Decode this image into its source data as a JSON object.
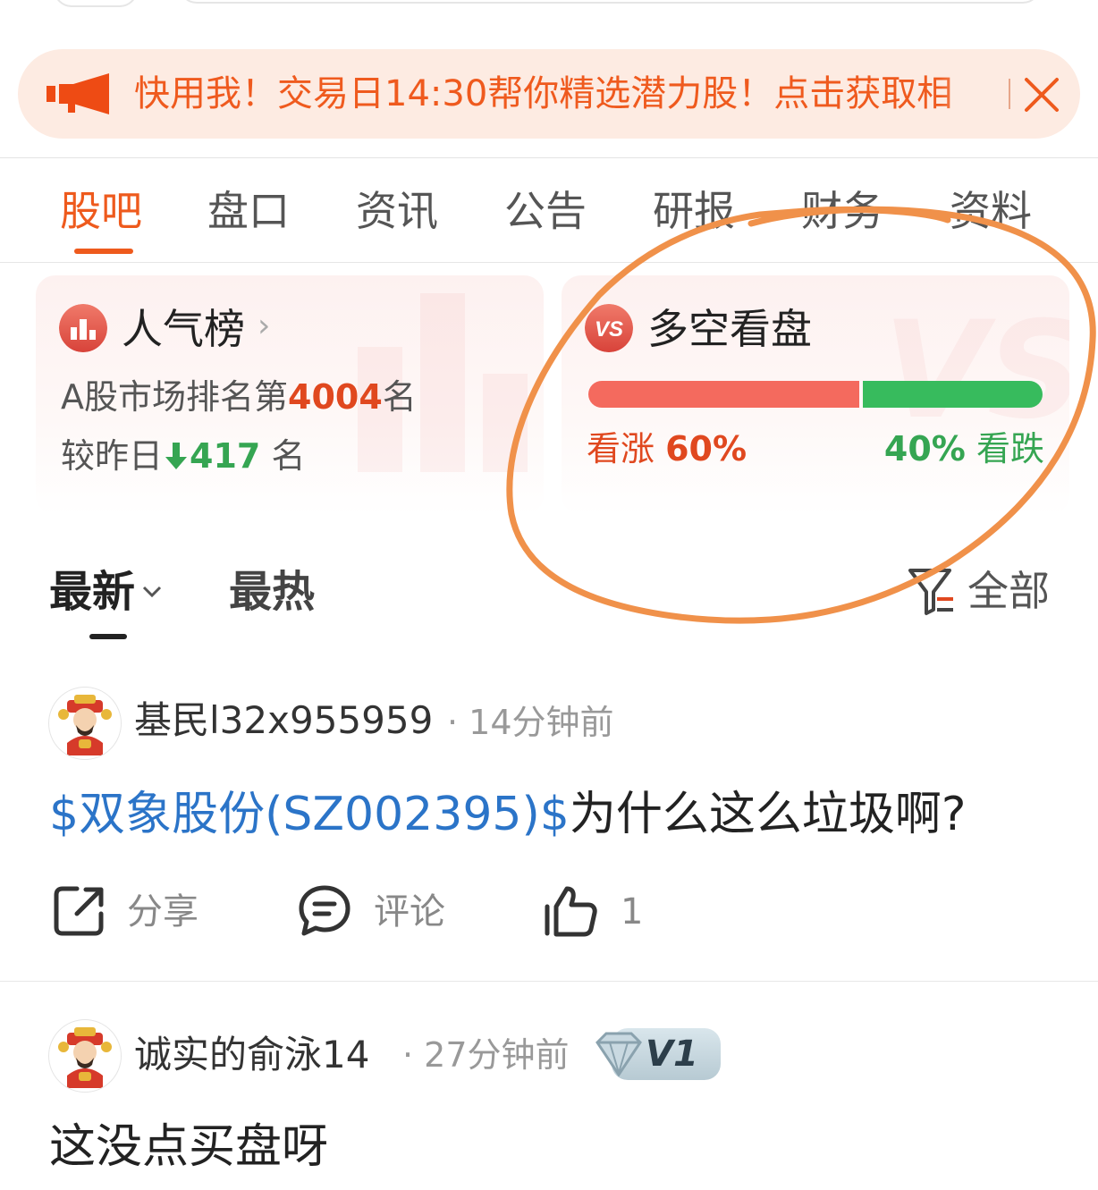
{
  "banner": {
    "text": "快用我！交易日14:30帮你精选潜力股！点击获取相",
    "icon": "megaphone-icon",
    "close_icon": "close-icon"
  },
  "tabs": [
    {
      "label": "股吧",
      "active": true
    },
    {
      "label": "盘口"
    },
    {
      "label": "资讯"
    },
    {
      "label": "公告"
    },
    {
      "label": "研报"
    },
    {
      "label": "财务"
    },
    {
      "label": "资料"
    }
  ],
  "popularity": {
    "title": "人气榜",
    "rank_prefix": "A股市场排名第",
    "rank": "4004",
    "rank_suffix": "名",
    "change_prefix": "较昨日",
    "change": "417",
    "change_suffix": "名"
  },
  "sentiment": {
    "title": "多空看盘",
    "badge": "VS",
    "bull_label": "看涨",
    "bull_pct": "60%",
    "bear_label": "看跌",
    "bear_pct": "40%",
    "bull_fraction": 0.6,
    "bull_color": "#f46a5e",
    "bear_color": "#37bb5d"
  },
  "sort": {
    "latest": "最新",
    "hot": "最热",
    "filter": "全部"
  },
  "posts": [
    {
      "user": "基民l32x955959",
      "time": "14分钟前",
      "stock_link": "$双象股份(SZ002395)$",
      "text": "为什么这么垃圾啊?",
      "share": "分享",
      "comment": "评论",
      "likes": "1"
    },
    {
      "user": "诚实的俞泳14",
      "time": "27分钟前",
      "level": "V1",
      "text": "这没点买盘呀"
    }
  ],
  "colors": {
    "accent": "#ee5a1d",
    "link": "#2b74c8",
    "annotation": "#f0914a"
  }
}
